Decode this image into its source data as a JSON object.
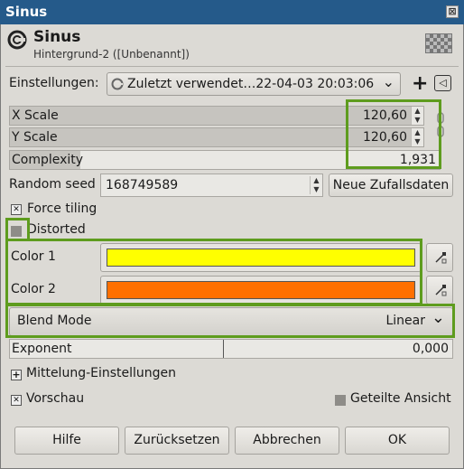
{
  "window": {
    "title": "Sinus",
    "close_glyph": "⊠"
  },
  "header": {
    "title": "Sinus",
    "subtitle": "Hintergrund-2 ([Unbenannt])",
    "icon": "gimp-filter-icon"
  },
  "settings": {
    "label": "Einstellungen:",
    "preset_value": "Zuletzt verwendet…22-04-03 20:03:06",
    "add_glyph": "+",
    "back_glyph": "◁"
  },
  "params": {
    "x_scale": {
      "label": "X Scale",
      "value": "120,60"
    },
    "y_scale": {
      "label": "Y Scale",
      "value": "120,60"
    },
    "complexity": {
      "label": "Complexity",
      "value": "1,931"
    },
    "random_seed": {
      "label": "Random seed",
      "value": "168749589",
      "new_seed_label": "Neue Zufallsdaten"
    },
    "force_tiling": {
      "label": "Force tiling",
      "checked": true
    },
    "distorted": {
      "label": "Distorted",
      "checked": false
    },
    "color1": {
      "label": "Color 1",
      "color": "#ffff00"
    },
    "color2": {
      "label": "Color 2",
      "color": "#ff7000"
    },
    "blend_mode": {
      "label": "Blend Mode",
      "value": "Linear"
    },
    "exponent": {
      "label": "Exponent",
      "value": "0,000"
    }
  },
  "sections": {
    "blending_options": {
      "label": "Mittelung-Einstellungen"
    },
    "preview": {
      "label": "Vorschau",
      "checked": true
    },
    "split_view": {
      "label": "Geteilte Ansicht",
      "checked": false
    }
  },
  "buttons": {
    "help": "Hilfe",
    "reset": "Zurücksetzen",
    "cancel": "Abbrechen",
    "ok": "OK"
  },
  "colors": {
    "highlight": "#5e9c1e",
    "titlebar": "#255a8a"
  },
  "glyphs": {
    "check": "✕",
    "chevron": "⌄",
    "up": "▲",
    "down": "▼",
    "expander": "+"
  }
}
